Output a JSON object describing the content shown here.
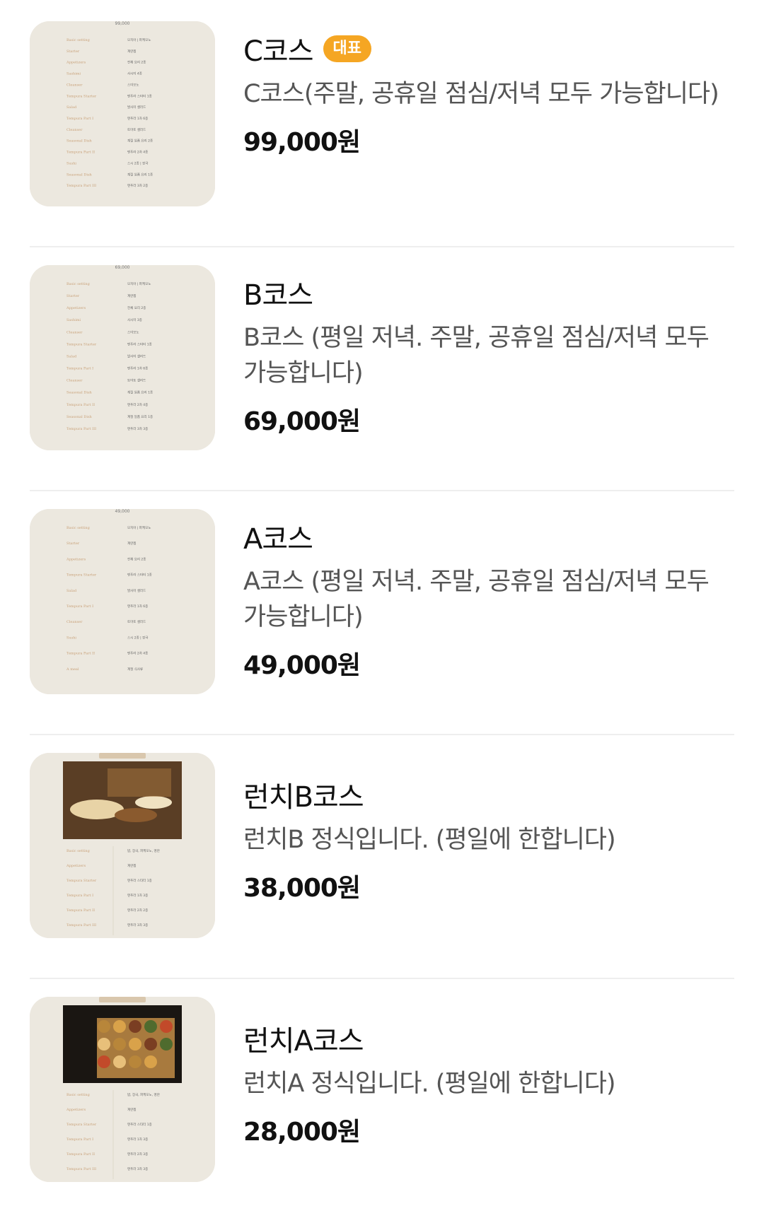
{
  "courses": [
    {
      "name": "C코스",
      "badge": "대표",
      "description": "C코스(주말, 공휴일 점심/저녁 모두 가능합니다)",
      "price": "99,000원",
      "thumb_top": "99,000",
      "thumb_rows": [
        {
          "label": "Basic setting",
          "value": "모치아 | 파케모노"
        },
        {
          "label": "Starter",
          "value": "계란찜"
        },
        {
          "label": "Appetizers",
          "value": "전채 요리 2종"
        },
        {
          "label": "Sashimi",
          "value": "사시미 4종"
        },
        {
          "label": "Cleanser",
          "value": "스미모노"
        },
        {
          "label": "Tempura Starter",
          "value": "텐푸라 스타터 1종"
        },
        {
          "label": "Salad",
          "value": "발사미 샐러드"
        },
        {
          "label": "Tempura Part I",
          "value": "텐푸라 1차 6종"
        },
        {
          "label": "Cleanser",
          "value": "토마토 샐러드"
        },
        {
          "label": "Seasonal Dish",
          "value": "계절 일품 요리 2종"
        },
        {
          "label": "Tempura Part II",
          "value": "텐푸라 2차 4종"
        },
        {
          "label": "Sushi",
          "value": "스시 2종 | 장국"
        },
        {
          "label": "Seasonal Dish",
          "value": "계절 일품 요리 1종"
        },
        {
          "label": "Tempura Part III",
          "value": "텐푸라 3차 2종"
        }
      ]
    },
    {
      "name": "B코스",
      "badge": "",
      "description": "B코스 (평일 저녁. 주말, 공휴일 점심/저녁 모두 가능합니다)",
      "price": "69,000원",
      "thumb_top": "69,000",
      "thumb_rows": [
        {
          "label": "Basic setting",
          "value": "모치아 | 파케모노"
        },
        {
          "label": "Starter",
          "value": "계란찜"
        },
        {
          "label": "Appetizers",
          "value": "전채 요리 2종"
        },
        {
          "label": "Sashimi",
          "value": "사시미 3종"
        },
        {
          "label": "Cleanser",
          "value": "스미모노"
        },
        {
          "label": "Tempura Starter",
          "value": "텐푸라 스타터 1종"
        },
        {
          "label": "Salad",
          "value": "발사미 샐러드"
        },
        {
          "label": "Tempura Part I",
          "value": "텐푸라 1차 6종"
        },
        {
          "label": "Cleanser",
          "value": "토마토 샐러드"
        },
        {
          "label": "Seasonal Dish",
          "value": "계절 일품 요리 1종"
        },
        {
          "label": "Tempura Part II",
          "value": "텐푸라 2차 4종"
        },
        {
          "label": "Seasonal Dish",
          "value": "계절 일품 요리 1종"
        },
        {
          "label": "Tempura Part III",
          "value": "텐푸라 3차 3종"
        }
      ]
    },
    {
      "name": "A코스",
      "badge": "",
      "description": "A코스 (평일 저녁. 주말, 공휴일 점심/저녁 모두 가능합니다)",
      "price": "49,000원",
      "thumb_top": "49,000",
      "thumb_rows": [
        {
          "label": "Basic setting",
          "value": "모치아 | 파케모노"
        },
        {
          "label": "Starter",
          "value": "계란찜"
        },
        {
          "label": "Appetizers",
          "value": "전채 요리 2종"
        },
        {
          "label": "Tempura Starter",
          "value": "텐푸라 스타터 1종"
        },
        {
          "label": "Salad",
          "value": "발사미 샐러드"
        },
        {
          "label": "Tempura Part I",
          "value": "텐푸라 1차 6종"
        },
        {
          "label": "Cleanser",
          "value": "토마토 샐러드"
        },
        {
          "label": "Sushi",
          "value": "스시 2종 | 장국"
        },
        {
          "label": "Tempura Part II",
          "value": "텐푸라 2차 4종"
        },
        {
          "label": "A meal",
          "value": "계절 식사류"
        }
      ]
    },
    {
      "name": "런치B코스",
      "badge": "",
      "description": "런치B 정식입니다. (평일에 한합니다)",
      "price": "38,000원",
      "thumb_top": "",
      "thumb_rows": [
        {
          "label": "Basic setting",
          "value": "밥, 장국, 파케모노, 명란"
        },
        {
          "label": "Appetizers",
          "value": "계란찜"
        },
        {
          "label": "Tempura Starter",
          "value": "텐푸라 스타터 1종"
        },
        {
          "label": "Tempura Part I",
          "value": "텐푸라 1차 3종"
        },
        {
          "label": "Tempura Part II",
          "value": "텐푸라 2차 2종"
        },
        {
          "label": "Tempura Part III",
          "value": "텐푸라 3차 3종"
        }
      ]
    },
    {
      "name": "런치A코스",
      "badge": "",
      "description": "런치A 정식입니다. (평일에 한합니다)",
      "price": "28,000원",
      "thumb_top": "",
      "thumb_rows": [
        {
          "label": "Basic setting",
          "value": "밥, 장국, 파케모노, 명란"
        },
        {
          "label": "Appetizers",
          "value": "계란찜"
        },
        {
          "label": "Tempura Starter",
          "value": "텐푸라 스타터 1종"
        },
        {
          "label": "Tempura Part I",
          "value": "텐푸라 1차 3종"
        },
        {
          "label": "Tempura Part II",
          "value": "텐푸라 2차 3종"
        },
        {
          "label": "Tempura Part III",
          "value": "텐푸라 3차 3종"
        }
      ]
    }
  ],
  "colors": {
    "badge": "#f5a623",
    "thumb_bg": "#ece8df",
    "thumb_label": "#c9a27a"
  }
}
